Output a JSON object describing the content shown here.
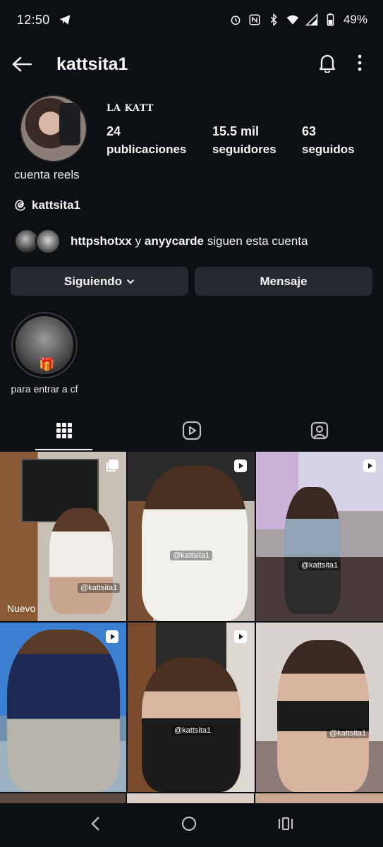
{
  "status_bar": {
    "time": "12:50",
    "battery": "49%",
    "icons": [
      "telegram-icon",
      "alarm-icon",
      "nfc-icon",
      "bluetooth-icon",
      "wifi-icon",
      "signal-icon",
      "battery-icon"
    ]
  },
  "header": {
    "username": "kattsita1",
    "icons": [
      "back-arrow-icon",
      "bell-icon",
      "more-vertical-icon"
    ]
  },
  "profile": {
    "display_name": "LA KATT",
    "stats": [
      {
        "value": "24",
        "label": "publicaciones"
      },
      {
        "value": "15.5 mil",
        "label": "seguidores"
      },
      {
        "value": "63",
        "label": "seguidos"
      }
    ],
    "bio": "cuenta reels",
    "threads_handle": "kattsita1",
    "mutual": {
      "user1": "httpshotxx",
      "connector": "y",
      "user2": "anyycarde",
      "suffix": "siguen esta cuenta"
    }
  },
  "buttons": {
    "following": "Siguiendo",
    "message": "Mensaje"
  },
  "highlight": {
    "label": "para entrar a cf"
  },
  "tabs": [
    "grid-icon",
    "reels-icon",
    "tagged-icon"
  ],
  "posts": [
    {
      "type": "carousel",
      "tag": "@kattsita1",
      "label": "Nuevo"
    },
    {
      "type": "reel",
      "tag": "@kattsita1"
    },
    {
      "type": "reel",
      "tag": "@kattsita1"
    },
    {
      "type": "reel",
      "tag": ""
    },
    {
      "type": "reel",
      "tag": "@kattsita1"
    },
    {
      "type": "reel",
      "tag": "@kattsita1"
    }
  ],
  "colors": {
    "background": "#0c1014",
    "button": "#262a30",
    "text": "#f5f5f5"
  }
}
